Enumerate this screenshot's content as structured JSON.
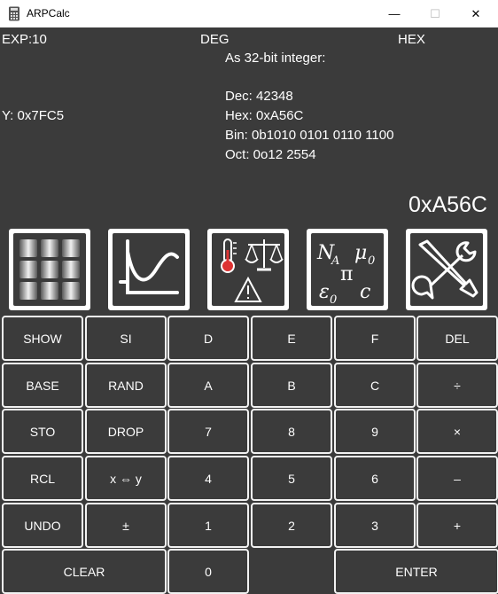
{
  "window": {
    "title": "ARPCalc",
    "minimize_glyph": "—",
    "maximize_glyph": "☐",
    "close_glyph": "✕"
  },
  "status": {
    "exp": "EXP:10",
    "angle": "DEG",
    "base": "HEX"
  },
  "info": {
    "heading": "As 32-bit integer:",
    "dec": "Dec: 42348",
    "hex": "Hex: 0xA56C",
    "bin": "Bin: 0b1010 0101 0110 1100",
    "oct": "Oct: 0o12 2554"
  },
  "stack": {
    "y": "Y: 0x7FC5",
    "x": "0xA56C"
  },
  "function_buttons": {
    "keypad": "keypad-icon",
    "graph": "graph-icon",
    "units": "units-conversion-icon",
    "constants": "constants-icon",
    "settings": "settings-tools-icon",
    "constants_symbols": [
      "N",
      "A",
      "μ",
      "0",
      "π",
      "ε",
      "0",
      "c"
    ]
  },
  "keys": {
    "show": "SHOW",
    "si": "SI",
    "d": "D",
    "e": "E",
    "f": "F",
    "del": "DEL",
    "base": "BASE",
    "rand": "RAND",
    "a": "A",
    "b": "B",
    "c": "C",
    "divide": "÷",
    "sto": "STO",
    "drop": "DROP",
    "seven": "7",
    "eight": "8",
    "nine": "9",
    "multiply": "×",
    "rcl": "RCL",
    "swap": "x ⇔ y",
    "four": "4",
    "five": "5",
    "six": "6",
    "minus": "–",
    "undo": "UNDO",
    "plusminus": "±",
    "one": "1",
    "two": "2",
    "three": "3",
    "plus": "+",
    "clear": "CLEAR",
    "zero": "0",
    "enter": "ENTER"
  },
  "colors": {
    "background": "#3b3b3b",
    "key_border": "#f2f2f2",
    "text": "#ffffff",
    "titlebar": "#ffffff"
  }
}
